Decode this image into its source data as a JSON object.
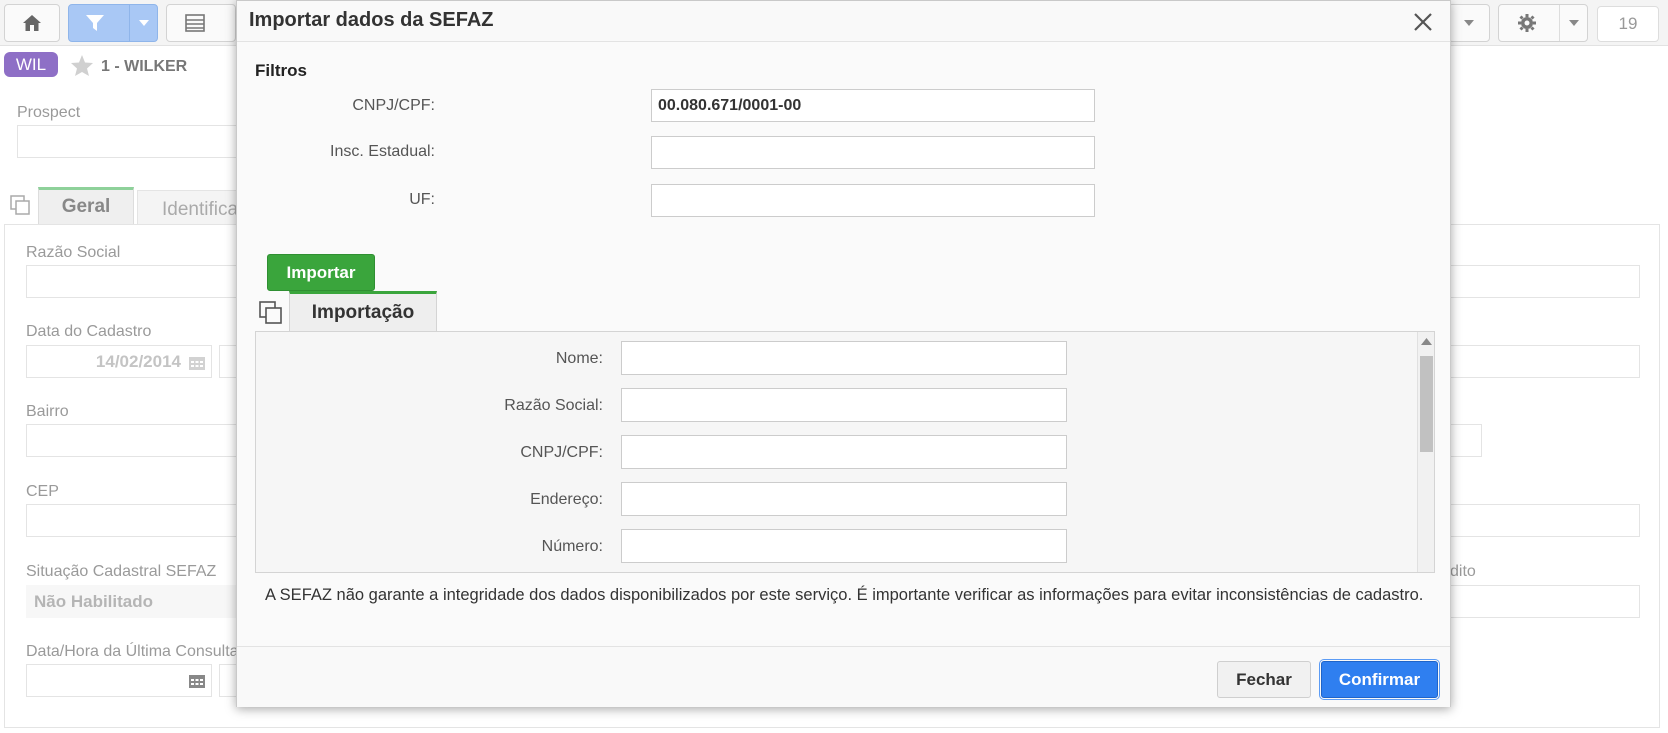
{
  "app": {
    "tenant_badge": "WIL",
    "record_label": "1 - WILKER",
    "page_count": "19",
    "fields": {
      "prospect": "Prospect",
      "razao_social": "Razão Social",
      "data_cadastro": "Data do Cadastro",
      "data_cadastro_value": "14/02/2014",
      "bairro": "Bairro",
      "cep": "CEP",
      "situacao": "Situação Cadastral SEFAZ",
      "situacao_value": "Não Habilitado",
      "ultima_consulta": "Data/Hora da Última Consulta",
      "credito_fragment": "dito"
    },
    "tabs": [
      {
        "label": "Geral"
      },
      {
        "label": "Identificação"
      }
    ]
  },
  "modal": {
    "title": "Importar dados da SEFAZ",
    "filters": {
      "title": "Filtros",
      "cnpj_label": "CNPJ/CPF:",
      "cnpj_value": "00.080.671/0001-00",
      "ie_label": "Insc. Estadual:",
      "ie_value": "",
      "uf_label": "UF:",
      "uf_value": ""
    },
    "import_button": "Importar",
    "import_tab": "Importação",
    "import_fields": [
      {
        "label": "Nome:",
        "value": ""
      },
      {
        "label": "Razão Social:",
        "value": ""
      },
      {
        "label": "CNPJ/CPF:",
        "value": ""
      },
      {
        "label": "Endereço:",
        "value": ""
      },
      {
        "label": "Número:",
        "value": ""
      }
    ],
    "disclaimer": "A SEFAZ não garante a integridade dos dados disponibilizados por este serviço. É importante verificar as informações para evitar inconsistências de cadastro.",
    "close_button": "Fechar",
    "confirm_button": "Confirmar"
  },
  "colors": {
    "primary": "#2f7ff0",
    "success": "#3aa53c",
    "badge": "#8e6fc6",
    "filter_active": "#a9c8f5"
  }
}
